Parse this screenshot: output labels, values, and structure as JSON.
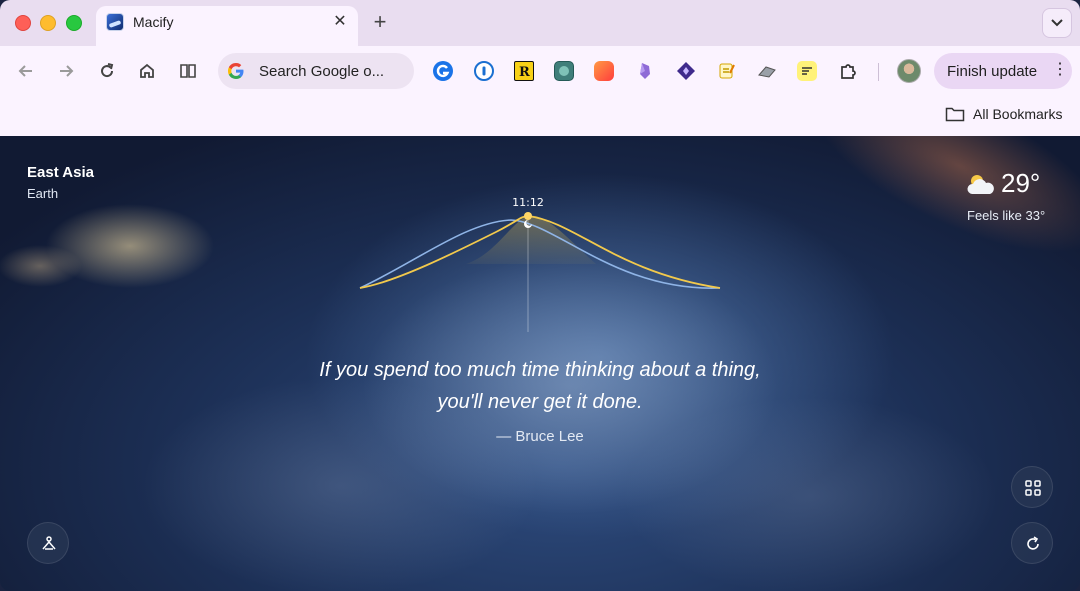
{
  "window": {
    "tab": {
      "title": "Macify"
    },
    "tab_menu_icon": "chevron-down-icon"
  },
  "toolbar": {
    "omnibox_text": "Search Google o...",
    "finish_update_label": "Finish update",
    "kebab": "⋮"
  },
  "bookmarks": {
    "all_label": "All Bookmarks"
  },
  "content": {
    "location": {
      "region": "East Asia",
      "planet": "Earth"
    },
    "weather": {
      "temp": "29°",
      "feels": "Feels like 33°",
      "icon": "partly-cloudy-icon"
    },
    "sun_chart": {
      "time_label": "11:12",
      "sun_color": "#f2c94c",
      "moon_color": "#8fb4e6"
    },
    "quote": {
      "line1": "If you spend too much time thinking about a thing,",
      "line2": "you'll never get it done.",
      "author": "— Bruce Lee"
    }
  },
  "extensions": [
    "macify-g-icon",
    "1password-icon",
    "readwise-r-icon",
    "screen-icon",
    "orange-app-icon",
    "obsidian-icon",
    "diamond-app-icon",
    "notes-icon",
    "raycast-icon",
    "highlighter-icon",
    "extensions-puzzle-icon"
  ]
}
